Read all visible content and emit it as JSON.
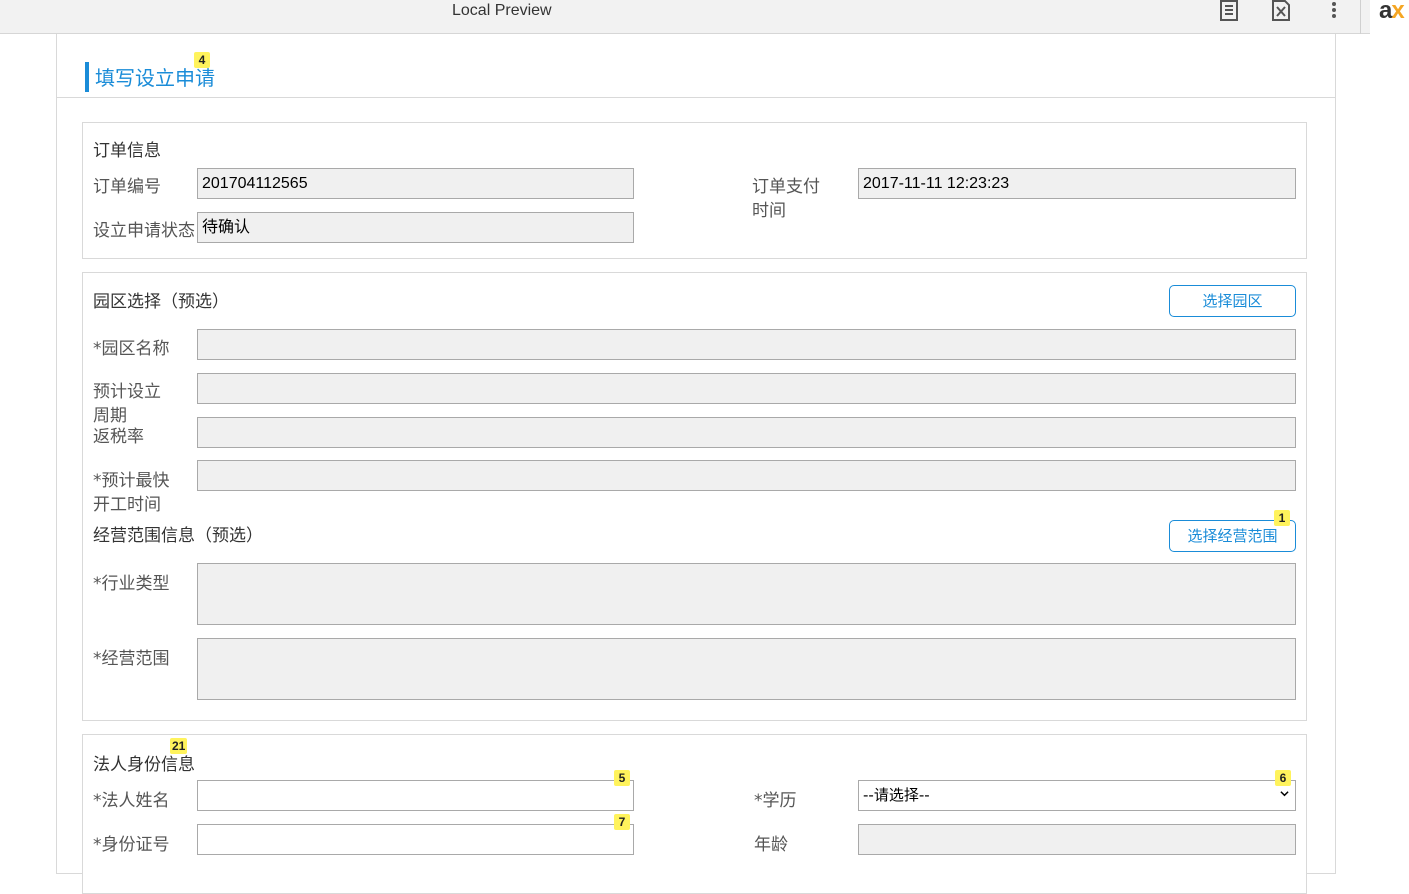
{
  "toolbar": {
    "title": "Local Preview",
    "icons": [
      "document-icon",
      "close-page-icon",
      "more-vert-icon"
    ],
    "brand": {
      "prefix": "a",
      "suffix": "x"
    }
  },
  "header": {
    "title": "填写设立申请",
    "badge": "4"
  },
  "order": {
    "title": "订单信息",
    "order_no_label": "订单编号",
    "order_no_value": "201704112565",
    "pay_time_label": "订单支付时间",
    "pay_time_value": "2017-11-11 12:23:23",
    "status_label": "设立申请状态",
    "status_value": "待确认"
  },
  "park": {
    "title": "园区选择（预选）",
    "select_button": "选择园区",
    "name_label": "*园区名称",
    "period_label": "预计设立周期",
    "rebate_label": "返税率",
    "start_label": "*预计最快开工时间"
  },
  "business": {
    "title": "经营范围信息（预选）",
    "select_button": "选择经营范围",
    "button_badge": "1",
    "industry_label": "*行业类型",
    "scope_label": "*经营范围"
  },
  "legal": {
    "title": "法人身份信息",
    "title_badge": "21",
    "name_label": "*法人姓名",
    "name_badge": "5",
    "education_label": "*学历",
    "education_value": "--请选择--",
    "education_badge": "6",
    "id_label": "*身份证号",
    "id_badge": "7",
    "age_label": "年龄"
  }
}
